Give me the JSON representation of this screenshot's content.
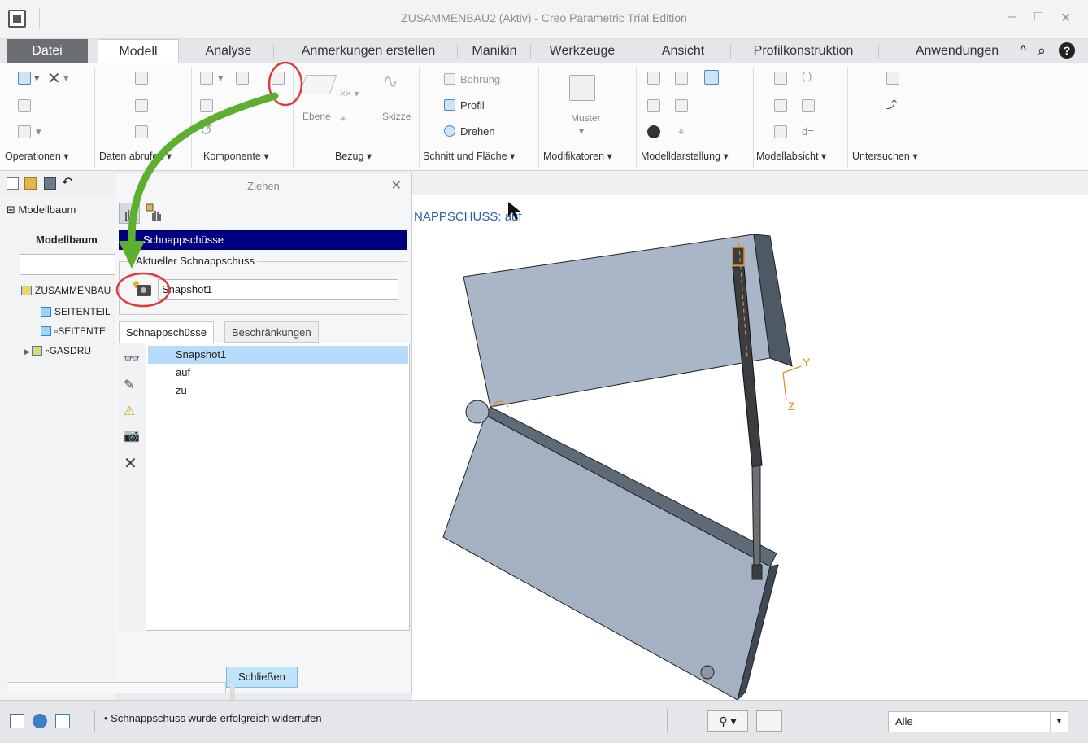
{
  "window": {
    "title": "ZUSAMMENBAU2 (Aktiv) - Creo Parametric Trial Edition",
    "controls": [
      "–",
      "□",
      "✕"
    ]
  },
  "tabs": [
    "Datei",
    "Modell",
    "Analyse",
    "Anmerkungen erstellen",
    "Manikin",
    "Werkzeuge",
    "Ansicht",
    "Profilkonstruktion",
    "Anwendungen"
  ],
  "active_tab": "Modell",
  "tab_icons": {
    "collapse": "^",
    "search": "⌕",
    "help": "?"
  },
  "ribbon": {
    "groups": [
      "Operationen ▾",
      "Daten abrufen ▾",
      "Komponente ▾",
      "Bezug ▾",
      "Schnitt und Fläche ▾",
      "Modifikatoren ▾",
      "Modelldarstellung ▾",
      "Modellabsicht ▾",
      "Untersuchen ▾"
    ],
    "bezug": {
      "ebene": "Ebene",
      "skizze": "Skizze"
    },
    "schnitt": {
      "bohrung": "Bohrung",
      "profil": "Profil",
      "drehen": "Drehen"
    },
    "modifikatoren": {
      "muster": "Muster"
    },
    "modellabsicht": {
      "d_eq": "d="
    }
  },
  "model_tree": {
    "header": "Modellbaum",
    "title": "Modellbaum",
    "items": [
      {
        "label": "ZUSAMMENBAU",
        "type": "asm"
      },
      {
        "label": "SEITENTEIL",
        "type": "prt"
      },
      {
        "label": "SEITENTE",
        "type": "prt"
      },
      {
        "label": "GASDRU",
        "type": "asm"
      }
    ]
  },
  "dialog": {
    "title": "Ziehen",
    "close": "✕",
    "section": "Schnappschüsse",
    "current_label": "Aktueller Schnappschuss",
    "current_value": "Snapshot1",
    "tabs": [
      "Schnappschüsse",
      "Beschränkungen"
    ],
    "list": [
      "Snapshot1",
      "auf",
      "zu"
    ],
    "selected": "Snapshot1",
    "close_button": "Schließen"
  },
  "viewport": {
    "label": "NAPPSCHUSS: auf",
    "axis_y": "Y",
    "axis_z": "Z"
  },
  "status": {
    "message": "• Schnappschuss wurde erfolgreich widerrufen",
    "filter_value": "Alle"
  },
  "colors": {
    "accent_bar": "#00007f",
    "selection": "#b7dcfb",
    "part": "#a5b4c6",
    "annotation_red": "#e0393e",
    "annotation_green": "#5eaf2f"
  }
}
